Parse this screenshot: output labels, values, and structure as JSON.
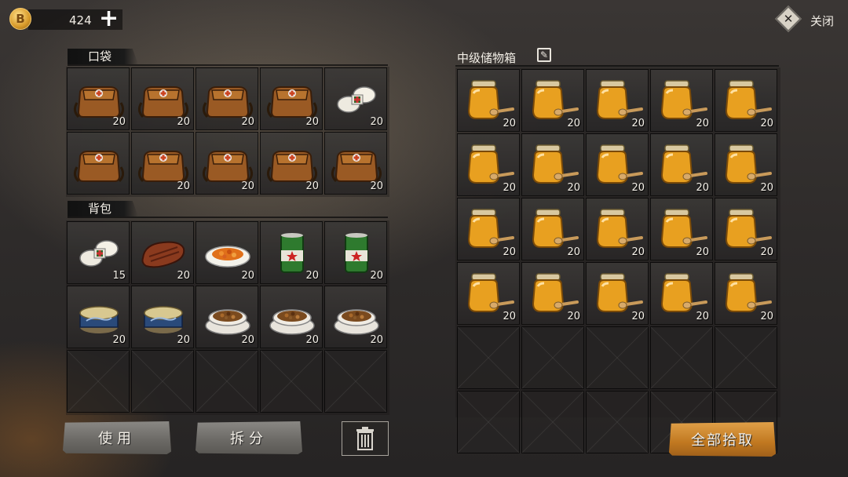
{
  "currency": {
    "icon": "coin-icon",
    "symbol": "B",
    "amount": "424",
    "add_label": "+"
  },
  "close": {
    "label": "关闭",
    "icon": "close-x-icon",
    "glyph": "✕"
  },
  "pocket": {
    "title": "口袋",
    "slots": [
      {
        "item": "medkit-bag",
        "count": "20"
      },
      {
        "item": "medkit-bag",
        "count": "20"
      },
      {
        "item": "medkit-bag",
        "count": "20"
      },
      {
        "item": "medkit-bag",
        "count": "20"
      },
      {
        "item": "bandage",
        "count": "20"
      },
      {
        "item": "medkit-bag",
        "count": ""
      },
      {
        "item": "medkit-bag",
        "count": "20"
      },
      {
        "item": "medkit-bag",
        "count": "20"
      },
      {
        "item": "medkit-bag",
        "count": "20"
      },
      {
        "item": "medkit-bag",
        "count": "20"
      }
    ]
  },
  "backpack": {
    "title": "背包",
    "slots": [
      {
        "item": "bandage",
        "count": "15"
      },
      {
        "item": "steak",
        "count": "20"
      },
      {
        "item": "fruit-plate",
        "count": "20"
      },
      {
        "item": "green-can",
        "count": "20"
      },
      {
        "item": "green-can",
        "count": "20"
      },
      {
        "item": "canned-fish",
        "count": "20"
      },
      {
        "item": "canned-fish",
        "count": "20"
      },
      {
        "item": "pet-food-bowl",
        "count": "20"
      },
      {
        "item": "pet-food-bowl",
        "count": "20"
      },
      {
        "item": "pet-food-bowl",
        "count": "20"
      },
      {
        "item": "",
        "count": ""
      },
      {
        "item": "",
        "count": ""
      },
      {
        "item": "",
        "count": ""
      },
      {
        "item": "",
        "count": ""
      },
      {
        "item": "",
        "count": ""
      }
    ]
  },
  "storage": {
    "title": "中级储物箱",
    "edit_icon": "edit-icon",
    "item_count": "20",
    "filled_item": "honey-jar"
  },
  "buttons": {
    "use": "使用",
    "split": "拆分",
    "delete_icon": "trash-icon",
    "collect_all": "全部拾取"
  },
  "colors": {
    "accent_gold": "#c07820",
    "button_gray": "#6a6864",
    "honey": "#e8a020"
  }
}
